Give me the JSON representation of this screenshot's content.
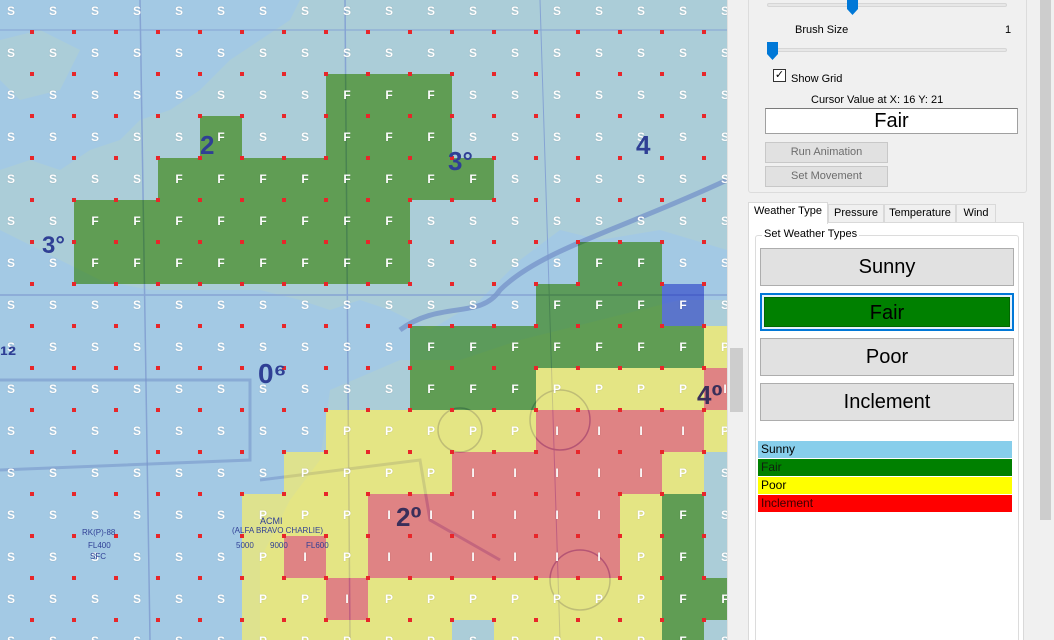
{
  "colors": {
    "sunny": "#7fb7dc",
    "fair": "#2f7f22",
    "poor": "#e7e45a",
    "inclement": "#e04050",
    "sunny_legend": "#87ceeb",
    "fair_legend": "#008000",
    "poor_legend": "#ffff00",
    "inclement_legend": "#ff0000",
    "grid_dot": "#e8262a",
    "accent": "#0078d7"
  },
  "map": {
    "symbols": {
      "sunny": "S",
      "fair": "F",
      "poor": "P",
      "inclement": "I"
    },
    "rows": [
      "SSSSSSSSSSSSSSSSSS",
      "SSSSSSSSSSSSSSSSSS",
      "SSSSSSSSFFFSSSSSSS",
      "SSSSSFSSFFFSSSSSSS",
      "SSSSFFFFFFFFSSSSSS",
      "SSFFFFFFFFSSSSSSSS",
      "SSFFFFFFFFSSSSFFSS",
      "SSSSSSSSSSSSSFFFFS",
      "SSSSSSSSSSFFFFFFFP",
      "SSSSSSSSSSFFFPPPPI",
      "SSSSSSSSPPPPPIIIIP",
      "SSSSSSSPPPPIIIIIPS",
      "SSSSSSPPPIIIIIIPFS",
      "SSSSSSPIPIIIIIIPFS",
      "SSSSSSPPIPPPPPPPFF",
      "SSSSSSPPPPPSPPPPFS"
    ],
    "special_cells": [
      {
        "row": 7,
        "col": 16,
        "type": "sunny_dark"
      }
    ],
    "labels": [
      "3°",
      "2",
      "3°",
      "4",
      "0⁶",
      "2⁰",
      "4⁰",
      "¹²",
      "RK(P)-88",
      "ACMI",
      "(ALFA BRAVO CHARLIE)",
      "FL400",
      "SFC",
      "5000",
      "9000",
      "FL600"
    ]
  },
  "controls": {
    "brush_size_label": "Brush Size",
    "brush_size_value": "1",
    "brush_size_fraction": 0.0,
    "top_slider_fraction": 0.35,
    "show_grid_label": "Show Grid",
    "show_grid_checked": "✓",
    "cursor_label": "Cursor Value at X: 16 Y: 21",
    "cursor_value": "Fair",
    "run_animation": "Run Animation",
    "set_movement": "Set Movement"
  },
  "tabs": [
    {
      "label": "Weather Type",
      "active": true
    },
    {
      "label": "Pressure",
      "active": false
    },
    {
      "label": "Temperature",
      "active": false
    },
    {
      "label": "Wind",
      "active": false
    }
  ],
  "weather": {
    "group_title": "Set Weather Types",
    "buttons": [
      "Sunny",
      "Fair",
      "Poor",
      "Inclement"
    ],
    "selected": "Fair",
    "legend": [
      "Sunny",
      "Fair",
      "Poor",
      "Inclement"
    ]
  }
}
